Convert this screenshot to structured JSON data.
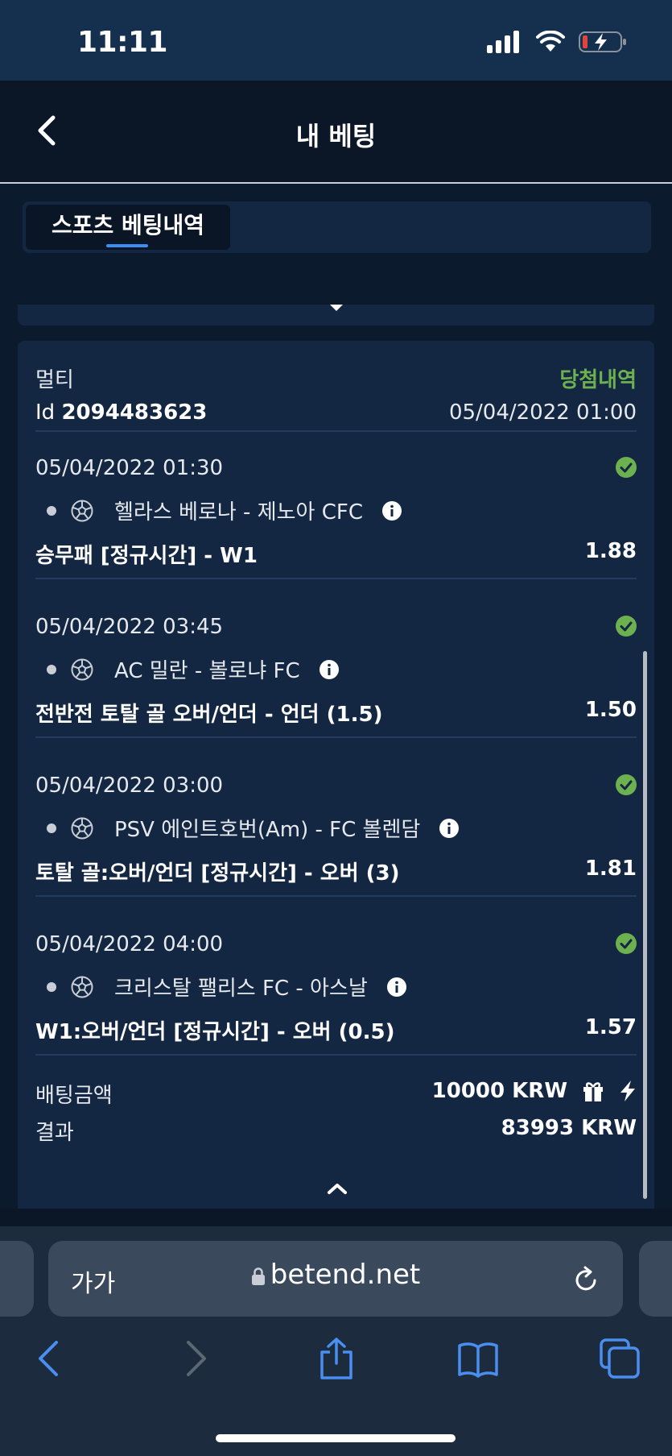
{
  "status_bar": {
    "time": "11:11"
  },
  "header": {
    "title": "내 베팅"
  },
  "tabs": [
    {
      "label": "스포츠 베팅내역",
      "active": true
    }
  ],
  "bet": {
    "type": "멀티",
    "status": "당첨내역",
    "id_label": "Id",
    "id_value": "2094483623",
    "placed_at": "05/04/2022 01:00",
    "selections": [
      {
        "datetime": "05/04/2022 01:30",
        "event": "헬라스 베로나 - 제노아 CFC",
        "market": "승무패 [정규시간] - W1",
        "odds": "1.88"
      },
      {
        "datetime": "05/04/2022 03:45",
        "event": "AC 밀란 - 볼로냐 FC",
        "market": "전반전 토탈 골 오버/언더 - 언더 (1.5)",
        "odds": "1.50"
      },
      {
        "datetime": "05/04/2022 03:00",
        "event": "PSV 에인트호번(Am) - FC 볼렌담",
        "market": "토탈 골:오버/언더 [정규시간] - 오버 (3)",
        "odds": "1.81"
      },
      {
        "datetime": "05/04/2022 04:00",
        "event": "크리스탈 팰리스 FC - 아스날",
        "market": "W1:오버/언더 [정규시간] - 오버 (0.5)",
        "odds": "1.57"
      }
    ],
    "stake_label": "배팅금액",
    "stake_value": "10000 KRW",
    "result_label": "결과",
    "result_value": "83993 KRW"
  },
  "browser": {
    "text_size_label": "가가",
    "url": "betend.net"
  },
  "colors": {
    "win": "#6db04f",
    "accent": "#3b8ef0",
    "card": "#142742",
    "browser_icon": "#4a8ef0"
  }
}
